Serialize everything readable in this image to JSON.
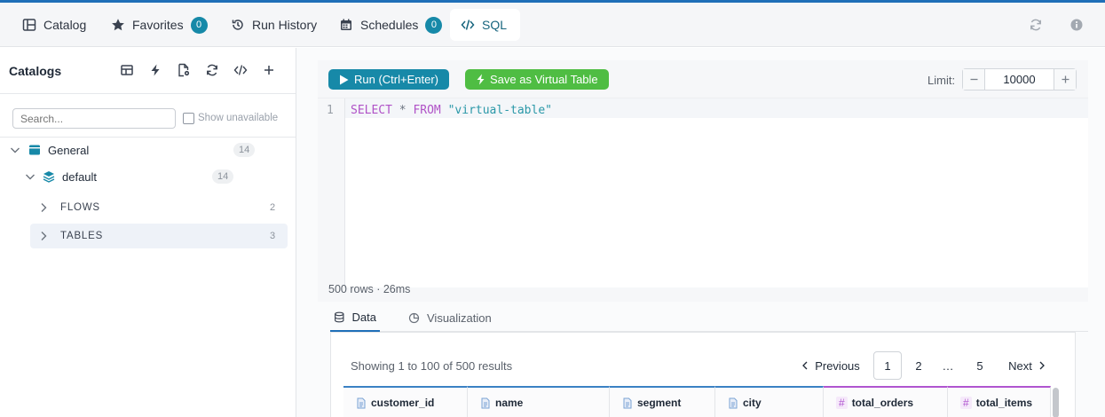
{
  "topnav": {
    "tabs": [
      {
        "label": "Catalog",
        "badge": null
      },
      {
        "label": "Favorites",
        "badge": "0"
      },
      {
        "label": "Run History",
        "badge": null
      },
      {
        "label": "Schedules",
        "badge": "0"
      },
      {
        "label": "SQL",
        "badge": null,
        "active": true
      }
    ],
    "icons": [
      "refresh-icon",
      "info-icon"
    ]
  },
  "sidebar": {
    "title": "Catalogs",
    "tool_icons": [
      "table-icon",
      "bolt-icon",
      "file-settings-icon",
      "refresh-icon",
      "code-icon",
      "plus-icon"
    ],
    "search_placeholder": "Search...",
    "show_unavailable_label": "Show unavailable",
    "tree": {
      "catalog": {
        "label": "General",
        "count": "14"
      },
      "schema": {
        "label": "default",
        "count": "14"
      },
      "groups": [
        {
          "label": "FLOWS",
          "count": "2"
        },
        {
          "label": "TABLES",
          "count": "3",
          "highlighted": true
        }
      ]
    }
  },
  "editor": {
    "run_label": "Run (Ctrl+Enter)",
    "save_label": "Save as Virtual Table",
    "limit_label": "Limit:",
    "limit_value": "10000",
    "line_number": "1",
    "code": {
      "kw1": "SELECT",
      "op": "*",
      "kw2": "FROM",
      "str": "\"virtual-table\""
    },
    "status": "500 rows · 26ms"
  },
  "results": {
    "tabs": [
      {
        "label": "Data",
        "active": true
      },
      {
        "label": "Visualization",
        "active": false
      }
    ],
    "showing": "Showing 1 to 100 of 500 results",
    "pagination": {
      "previous": "Previous",
      "pages": [
        "1",
        "2",
        "…",
        "5"
      ],
      "current": "1",
      "next": "Next"
    },
    "columns": [
      {
        "name": "customer_id",
        "type": "text"
      },
      {
        "name": "name",
        "type": "text"
      },
      {
        "name": "segment",
        "type": "text"
      },
      {
        "name": "city",
        "type": "text"
      },
      {
        "name": "total_orders",
        "type": "number",
        "type_glyph": "#"
      },
      {
        "name": "total_items",
        "type": "number",
        "type_glyph": "#"
      }
    ]
  },
  "colors": {
    "accent": "#1789a8",
    "save_green": "#4fbd43",
    "text_col_border": "#3b82c4",
    "num_col_border": "#b055d0",
    "keyword": "#b052c7",
    "string": "#2a98a8"
  }
}
